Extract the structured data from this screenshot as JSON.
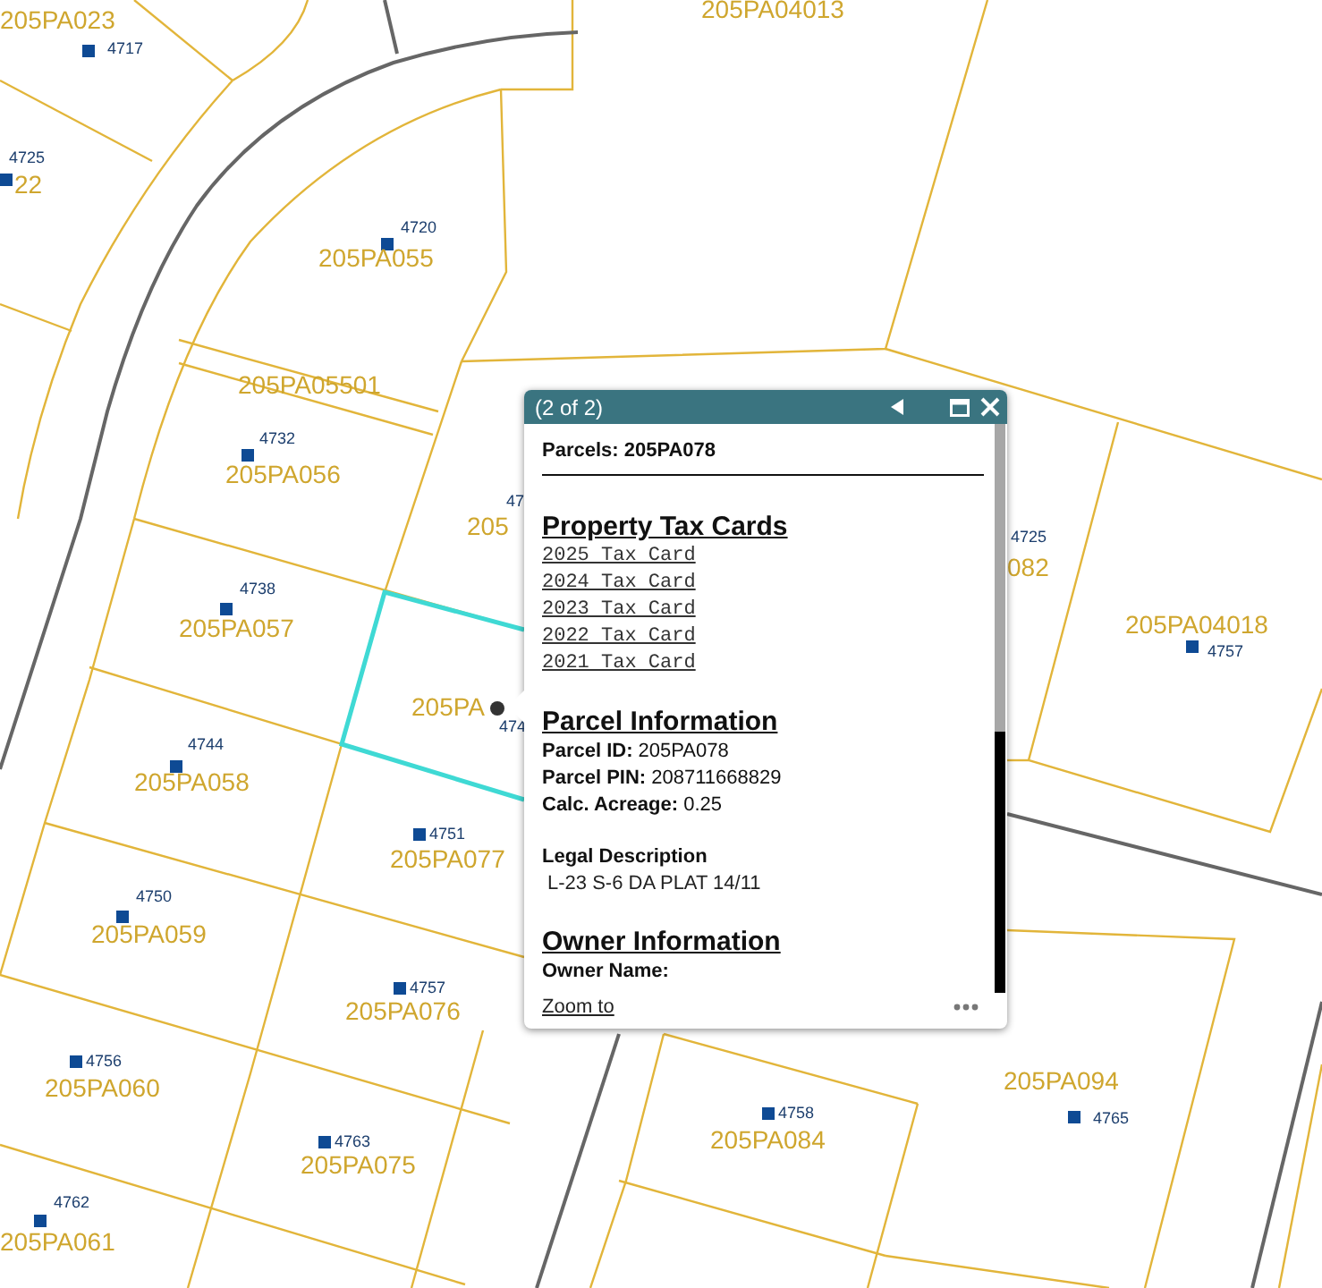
{
  "map": {
    "labels": [
      {
        "kind": "parcel",
        "text": "205PA023"
      },
      {
        "kind": "parcel",
        "text": "22"
      },
      {
        "kind": "parcel",
        "text": "205PA04013"
      },
      {
        "kind": "parcel",
        "text": "205PA055"
      },
      {
        "kind": "parcel",
        "text": "205PA05501"
      },
      {
        "kind": "parcel",
        "text": "205PA056"
      },
      {
        "kind": "parcel",
        "text": "205"
      },
      {
        "kind": "parcel",
        "text": "205PA057"
      },
      {
        "kind": "parcel",
        "text": "205PA"
      },
      {
        "kind": "parcel",
        "text": "205PA058"
      },
      {
        "kind": "parcel",
        "text": "205PA077"
      },
      {
        "kind": "parcel",
        "text": "205PA059"
      },
      {
        "kind": "parcel",
        "text": "205PA076"
      },
      {
        "kind": "parcel",
        "text": "205PA060"
      },
      {
        "kind": "parcel",
        "text": "205PA075"
      },
      {
        "kind": "parcel",
        "text": "205PA061"
      },
      {
        "kind": "parcel",
        "text": "082"
      },
      {
        "kind": "parcel",
        "text": "205PA04018"
      },
      {
        "kind": "parcel",
        "text": "205PA094"
      },
      {
        "kind": "parcel",
        "text": "205PA084"
      },
      {
        "kind": "address",
        "text": "4717"
      },
      {
        "kind": "address",
        "text": "4725"
      },
      {
        "kind": "address",
        "text": "4720"
      },
      {
        "kind": "address",
        "text": "4732"
      },
      {
        "kind": "address",
        "text": "47"
      },
      {
        "kind": "address",
        "text": "4738"
      },
      {
        "kind": "address",
        "text": "474"
      },
      {
        "kind": "address",
        "text": "4744"
      },
      {
        "kind": "address",
        "text": "4751"
      },
      {
        "kind": "address",
        "text": "4750"
      },
      {
        "kind": "address",
        "text": "4757"
      },
      {
        "kind": "address",
        "text": "4756"
      },
      {
        "kind": "address",
        "text": "4763"
      },
      {
        "kind": "address",
        "text": "4762"
      },
      {
        "kind": "address",
        "text": "4725"
      },
      {
        "kind": "address",
        "text": "4757"
      },
      {
        "kind": "address",
        "text": "4758"
      },
      {
        "kind": "address",
        "text": "4765"
      }
    ]
  },
  "popup": {
    "title": "(2 of 2)",
    "summary": "Parcels: 205PA078",
    "sections": [
      {
        "heading": "Property Tax Cards",
        "items": [
          {
            "kind": "link",
            "text": "2025 Tax Card"
          },
          {
            "kind": "link",
            "text": "2024 Tax Card"
          },
          {
            "kind": "link",
            "text": "2023 Tax Card"
          },
          {
            "kind": "link",
            "text": "2022 Tax Card"
          },
          {
            "kind": "link",
            "text": "2021 Tax Card"
          }
        ]
      },
      {
        "heading": "Parcel Information",
        "items": [
          {
            "kind": "field",
            "text": "**Parcel ID:** 205PA078"
          },
          {
            "kind": "field",
            "text": "**Parcel PIN:** 208711668829"
          },
          {
            "kind": "field",
            "text": "**Calc. Acreage:** 0.25"
          },
          {
            "kind": "label",
            "text": "**Legal Description**"
          },
          {
            "kind": "value",
            "text": "L-23 S-6 DA PLAT 14/11"
          }
        ]
      },
      {
        "heading": "Owner Information",
        "items": [
          {
            "kind": "label",
            "text": "**Owner Name:**"
          }
        ]
      }
    ],
    "footer_link": "Zoom to"
  }
}
